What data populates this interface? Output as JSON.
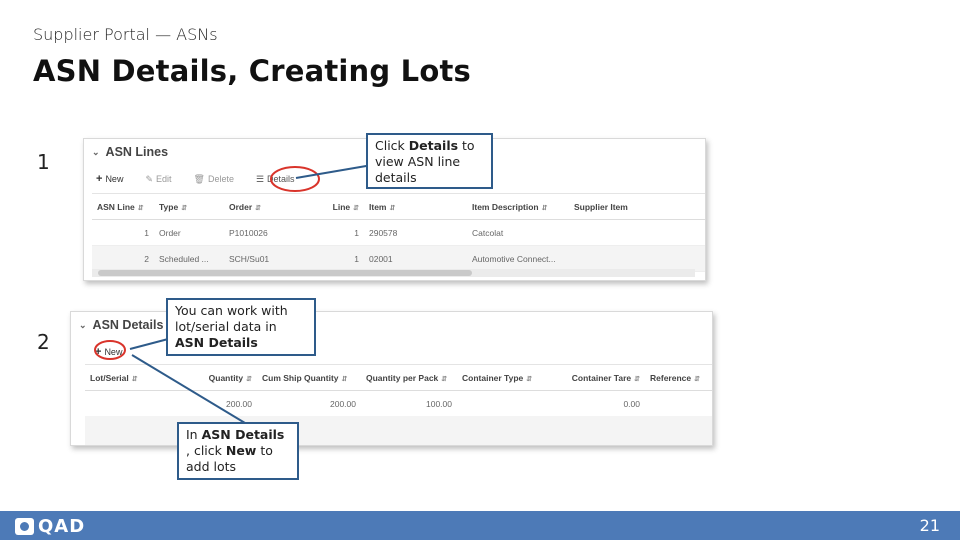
{
  "slide": {
    "subtitle": "Supplier Portal — ASNs",
    "title": "ASN Details, Creating Lots",
    "page_number": "21",
    "brand": "QAD"
  },
  "steps": [
    "1",
    "2"
  ],
  "asn_lines_panel": {
    "header": "ASN Lines",
    "toolbar": {
      "new": "New",
      "edit": "Edit",
      "delete": "Delete",
      "details": "Details"
    },
    "columns": [
      "ASN Line",
      "Type",
      "Order",
      "Line",
      "Item",
      "Item Description",
      "Supplier Item"
    ],
    "rows": [
      [
        "1",
        "Order",
        "P1010026",
        "1",
        "290578",
        "Catcolat",
        ""
      ],
      [
        "2",
        "Scheduled ...",
        "SCH/Su01",
        "1",
        "02001",
        "Automotive Connect...",
        ""
      ]
    ]
  },
  "asn_details_panel": {
    "header": "ASN Details",
    "toolbar": {
      "new": "New"
    },
    "columns": [
      "Lot/Serial",
      "Quantity",
      "Cum Ship Quantity",
      "Quantity per Pack",
      "Container Type",
      "Container Tare",
      "Reference"
    ],
    "rows": [
      [
        "",
        "200.00",
        "200.00",
        "100.00",
        "",
        "0.00",
        ""
      ]
    ]
  },
  "callouts": {
    "details": {
      "pre": "Click ",
      "bold": "Details",
      "post": " to view ASN line details"
    },
    "lots": {
      "pre": "You can work with lot/serial data in ",
      "bold": "ASN Details",
      "post": ""
    },
    "new": {
      "pre": "In ",
      "bold": "ASN Details",
      "mid": " , click ",
      "bold2": "New",
      "post": " to add lots"
    }
  },
  "colors": {
    "footer": "#4d7ab7",
    "callout_border": "#2e5b8a",
    "highlight": "#d9342b"
  }
}
